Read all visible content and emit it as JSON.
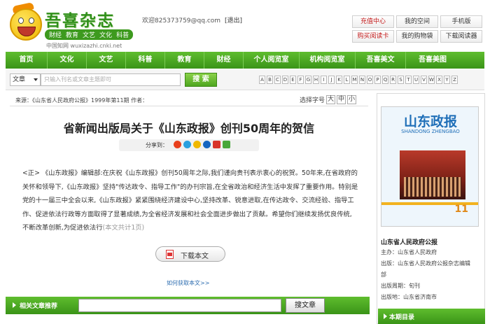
{
  "logo": {
    "title": "吾喜杂志",
    "categories": [
      "财经",
      "教育",
      "文艺",
      "文化",
      "科普"
    ],
    "site_line": "中国知网 wuxizazhi.cnki.net"
  },
  "header": {
    "user_email": "欢迎825373759@qq.com",
    "logout": "[退出]",
    "buttons": [
      "充值中心",
      "我的空间",
      "手机版",
      "购买阅读卡",
      "我的购物袋",
      "下载阅读器"
    ]
  },
  "nav": {
    "items": [
      "首页",
      "文化",
      "文艺",
      "科普",
      "教育",
      "财经",
      "个人阅览室",
      "机构阅览室",
      "吾喜美文",
      "吾喜美图"
    ]
  },
  "search": {
    "select_value": "文章",
    "placeholder": "只输入刊名或文章主题即可",
    "button": "搜 索",
    "letters": [
      "A",
      "B",
      "C",
      "D",
      "E",
      "F",
      "G",
      "H",
      "I",
      "J",
      "K",
      "L",
      "M",
      "N",
      "O",
      "P",
      "Q",
      "R",
      "S",
      "T",
      "U",
      "V",
      "W",
      "X",
      "Y",
      "Z"
    ]
  },
  "article": {
    "source_line": "来源：《山东省人民政府公报》1999年第11期 作者：",
    "font_size_label": "选择字号",
    "font_sizes": [
      "大",
      "中",
      "小"
    ],
    "title": "省新闻出版局关于《山东政报》创刊50周年的贺信",
    "share_label": "分享到：",
    "body_main": "<正> 《山东政报》编辑部:在庆祝《山东政报》创刊50周年之际,我们谨向贵刊表示衷心的祝贺。50年来,在省政府的关怀和领导下,《山东政报》坚持\"传达政令、指导工作\"的办刊宗旨,在全省政治和经济生活中发挥了重要作用。特别是党的十一届三中全会以来,《山东政报》紧紧围绕经济建设中心,坚持改革、锐意进取,在传达政令、交流经验、指导工作、促进依法行政等方面取得了显著成绩,为全省经济发展和社会全面进步做出了贡献。希望你们继续发扬优良传统,不断改革创新,为促进依法行",
    "body_count": "(本文共计1页)",
    "download": "下载本文",
    "howto": "如何获取本文>>"
  },
  "related": {
    "title": "相关文章推荐",
    "button": "搜文章"
  },
  "sidebar": {
    "cover_title": "山东政报",
    "cover_sub": "SHANDONG ZHENGBAO",
    "cover_issue": "11",
    "magazine_name": "山东省人民政府公报",
    "info": [
      "主办：山东省人民政府",
      "出版：山东省人民政府公报杂志编辑",
      "部",
      "出版周期：旬刊",
      "出版地：山东省济南市"
    ],
    "toc_title": "本期目录"
  },
  "colors": {
    "nav_green": "#3a9418",
    "logo_green": "#2f8f1a",
    "link_blue": "#2d6db0",
    "alert_red": "#c31a1a"
  }
}
